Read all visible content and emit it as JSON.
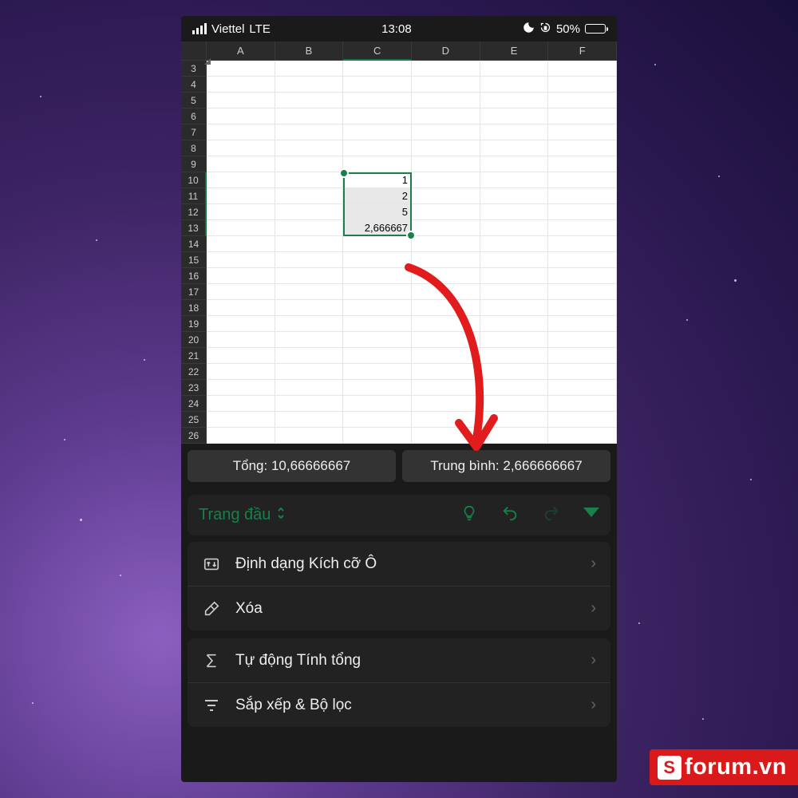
{
  "status": {
    "carrier": "Viettel",
    "network": "LTE",
    "time": "13:08",
    "battery_pct": "50%"
  },
  "grid": {
    "columns": [
      "A",
      "B",
      "C",
      "D",
      "E",
      "F"
    ],
    "first_row": 3,
    "last_row": 26,
    "selected_col": "C",
    "selected_rows": [
      10,
      11,
      12,
      13
    ],
    "cells": {
      "C10": "1",
      "C11": "2",
      "C12": "5",
      "C13": "2,666667"
    }
  },
  "stats": {
    "sum_label": "Tổng: 10,66666667",
    "avg_label": "Trung bình: 2,666666667"
  },
  "ribbon": {
    "tab_label": "Trang đầu"
  },
  "menu1": {
    "item1": "Định dạng Kích cỡ Ô",
    "item2": "Xóa"
  },
  "menu2": {
    "item1": "Tự động Tính tổng",
    "item2": "Sắp xếp & Bộ lọc"
  },
  "watermark": {
    "s": "S",
    "text": "forum.vn"
  }
}
